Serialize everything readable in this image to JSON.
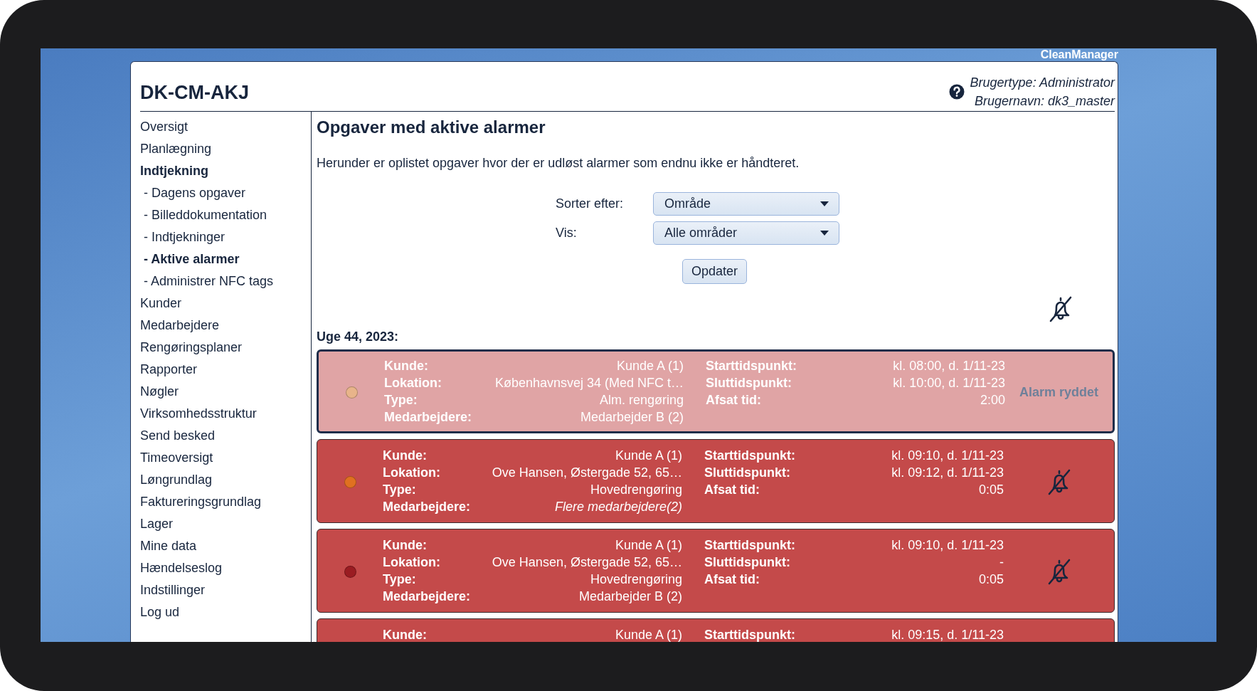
{
  "app_name": "CleanManager",
  "header": {
    "title": "DK-CM-AKJ",
    "user_type": "Brugertype: Administrator",
    "user_name": "Brugernavn: dk3_master"
  },
  "sidebar": {
    "items": [
      {
        "label": "Oversigt",
        "expanded": false
      },
      {
        "label": "Planlægning",
        "expanded": false
      },
      {
        "label": "Indtjekning",
        "expanded": true,
        "children": [
          {
            "label": "- Dagens opgaver",
            "selected": false
          },
          {
            "label": "- Billeddokumentation",
            "selected": false
          },
          {
            "label": "- Indtjekninger",
            "selected": false
          },
          {
            "label": "- Aktive alarmer",
            "selected": true
          },
          {
            "label": "- Administrer NFC tags",
            "selected": false
          }
        ]
      },
      {
        "label": "Kunder",
        "expanded": false
      },
      {
        "label": "Medarbejdere",
        "expanded": false
      },
      {
        "label": "Rengøringsplaner",
        "expanded": false
      },
      {
        "label": "Rapporter",
        "expanded": false
      },
      {
        "label": "Nøgler",
        "expanded": false
      },
      {
        "label": "Virksomhedsstruktur",
        "expanded": false
      },
      {
        "label": "Send besked",
        "expanded": false
      },
      {
        "label": "Timeoversigt",
        "expanded": false
      },
      {
        "label": "Løngrundlag",
        "expanded": false
      },
      {
        "label": "Faktureringsgrundlag",
        "expanded": false
      },
      {
        "label": "Lager",
        "expanded": false
      },
      {
        "label": "Mine data",
        "expanded": false
      },
      {
        "label": "Hændelseslog",
        "expanded": false
      },
      {
        "label": "Indstillinger",
        "expanded": false
      },
      {
        "label": "Log ud",
        "expanded": false
      }
    ]
  },
  "content": {
    "title": "Opgaver med aktive alarmer",
    "intro": "Herunder er oplistet opgaver hvor der er udløst alarmer som endnu ikke er håndteret.",
    "filters": [
      {
        "label": "Sorter efter:",
        "value": "Område"
      },
      {
        "label": "Vis:",
        "value": "Alle områder"
      }
    ],
    "update_button": "Opdater",
    "week_heading": "Uge 44, 2023:",
    "alarms": [
      {
        "selected": true,
        "cleared": true,
        "color": "#e8b48a",
        "action": {
          "kind": "text",
          "text": "Alarm ryddet"
        },
        "fields": [
          {
            "label": "Kunde:",
            "value": "Kunde A (1)",
            "italic": false
          },
          {
            "label": "Lokation:",
            "value": "Københavnsvej 34 (Med NFC t…",
            "italic": false
          },
          {
            "label": "Type:",
            "value": "Alm. rengøring",
            "italic": false
          },
          {
            "label": "Medarbejdere:",
            "value": "Medarbejder B (2)",
            "italic": false
          }
        ],
        "times": [
          {
            "label": "Starttidspunkt:",
            "value": "kl. 08:00, d. 1/11-23"
          },
          {
            "label": "Sluttidspunkt:",
            "value": "kl. 10:00, d. 1/11-23"
          },
          {
            "label": "Afsat tid:",
            "value": "2:00"
          }
        ]
      },
      {
        "selected": false,
        "cleared": false,
        "color": "#e07020",
        "action": {
          "kind": "mute_button"
        },
        "fields": [
          {
            "label": "Kunde:",
            "value": "Kunde A (1)",
            "italic": false
          },
          {
            "label": "Lokation:",
            "value": "Ove Hansen, Østergade 52, 65…",
            "italic": false
          },
          {
            "label": "Type:",
            "value": "Hovedrengøring",
            "italic": false
          },
          {
            "label": "Medarbejdere:",
            "value": "Flere medarbejdere(2)",
            "italic": true
          }
        ],
        "times": [
          {
            "label": "Starttidspunkt:",
            "value": "kl. 09:10, d. 1/11-23"
          },
          {
            "label": "Sluttidspunkt:",
            "value": "kl. 09:12, d. 1/11-23"
          },
          {
            "label": "Afsat tid:",
            "value": "0:05"
          }
        ]
      },
      {
        "selected": false,
        "cleared": false,
        "color": "#9a1c22",
        "action": {
          "kind": "mute_button"
        },
        "fields": [
          {
            "label": "Kunde:",
            "value": "Kunde A (1)",
            "italic": false
          },
          {
            "label": "Lokation:",
            "value": "Ove Hansen, Østergade 52, 65…",
            "italic": false
          },
          {
            "label": "Type:",
            "value": "Hovedrengøring",
            "italic": false
          },
          {
            "label": "Medarbejdere:",
            "value": "Medarbejder B (2)",
            "italic": false
          }
        ],
        "times": [
          {
            "label": "Starttidspunkt:",
            "value": "kl. 09:10, d. 1/11-23"
          },
          {
            "label": "Sluttidspunkt:",
            "value": "-"
          },
          {
            "label": "Afsat tid:",
            "value": "0:05"
          }
        ]
      },
      {
        "selected": false,
        "cleared": false,
        "fields": [
          {
            "label": "Kunde:",
            "value": "Kunde A (1)",
            "italic": false
          }
        ],
        "times": [
          {
            "label": "Starttidspunkt:",
            "value": "kl. 09:15, d. 1/11-23"
          }
        ]
      }
    ]
  }
}
